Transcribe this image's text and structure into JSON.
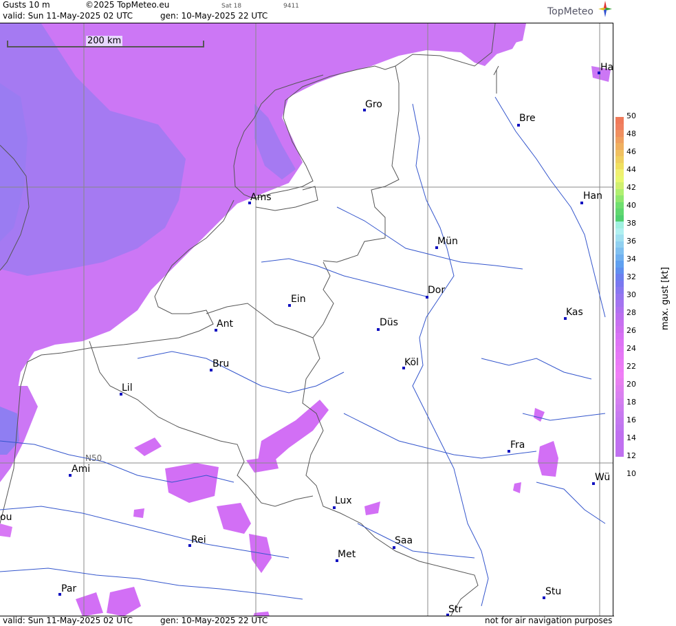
{
  "header": {
    "product": "Gusts 10 m",
    "copyright": "©2025 TopMeteo.eu",
    "valid": "valid:  Sun  11-May-2025  02 UTC",
    "gen": "gen: 10-May-2025 22 UTC",
    "sat": "Sat 18",
    "code": "9411",
    "logo": "TopMeteo"
  },
  "footer": {
    "valid": "valid:  Sun  11-May-2025  02 UTC",
    "gen": "gen: 10-May-2025 22 UTC",
    "note": "not for air navigation purposes"
  },
  "scale": {
    "label": "200 km"
  },
  "grid": {
    "lat_label": "N50"
  },
  "cities": [
    {
      "name": "Gro",
      "dot": [
        528,
        157
      ],
      "text": [
        531,
        143
      ]
    },
    {
      "name": "Bre",
      "dot": [
        752,
        179
      ],
      "text": [
        755,
        163
      ]
    },
    {
      "name": "Ha",
      "dot": [
        869,
        103
      ],
      "text": [
        873,
        89
      ]
    },
    {
      "name": "Ams",
      "dot": [
        361,
        292
      ],
      "text": [
        364,
        278
      ]
    },
    {
      "name": "Han",
      "dot": [
        844,
        292
      ],
      "text": [
        848,
        276
      ]
    },
    {
      "name": "Mün",
      "dot": [
        633,
        357
      ],
      "text": [
        636,
        342
      ]
    },
    {
      "name": "Dor",
      "dot": [
        619,
        429
      ],
      "text": [
        622,
        413
      ]
    },
    {
      "name": "Ein",
      "dot": [
        419,
        441
      ],
      "text": [
        423,
        426
      ]
    },
    {
      "name": "Kas",
      "dot": [
        820,
        460
      ],
      "text": [
        823,
        445
      ]
    },
    {
      "name": "Düs",
      "dot": [
        548,
        476
      ],
      "text": [
        552,
        460
      ]
    },
    {
      "name": "Ant",
      "dot": [
        312,
        477
      ],
      "text": [
        315,
        462
      ]
    },
    {
      "name": "Köl",
      "dot": [
        585,
        532
      ],
      "text": [
        588,
        518
      ]
    },
    {
      "name": "Bru",
      "dot": [
        305,
        535
      ],
      "text": [
        309,
        520
      ]
    },
    {
      "name": "Lil",
      "dot": [
        174,
        570
      ],
      "text": [
        177,
        555
      ]
    },
    {
      "name": "Fra",
      "dot": [
        738,
        653
      ],
      "text": [
        742,
        638
      ]
    },
    {
      "name": "Ami",
      "dot": [
        100,
        688
      ],
      "text": [
        104,
        673
      ]
    },
    {
      "name": "Wü",
      "dot": [
        861,
        700
      ],
      "text": [
        865,
        685
      ]
    },
    {
      "name": "Lux",
      "dot": [
        484,
        735
      ],
      "text": [
        487,
        719
      ]
    },
    {
      "name": "ou",
      "dot": [
        -10,
        758
      ],
      "text": [
        0,
        743
      ]
    },
    {
      "name": "Rei",
      "dot": [
        274,
        790
      ],
      "text": [
        278,
        776
      ]
    },
    {
      "name": "Saa",
      "dot": [
        571,
        793
      ],
      "text": [
        574,
        777
      ]
    },
    {
      "name": "Met",
      "dot": [
        488,
        812
      ],
      "text": [
        491,
        797
      ]
    },
    {
      "name": "Par",
      "dot": [
        85,
        861
      ],
      "text": [
        89,
        847
      ]
    },
    {
      "name": "Stu",
      "dot": [
        789,
        866
      ],
      "text": [
        793,
        851
      ]
    },
    {
      "name": "Str",
      "dot": [
        649,
        891
      ],
      "text": [
        652,
        877
      ]
    }
  ],
  "legend": {
    "title": "max. gust [kt]",
    "ticks": [
      50,
      48,
      46,
      44,
      42,
      40,
      38,
      36,
      34,
      32,
      30,
      28,
      26,
      24,
      22,
      20,
      18,
      16,
      14,
      12,
      10
    ]
  }
}
